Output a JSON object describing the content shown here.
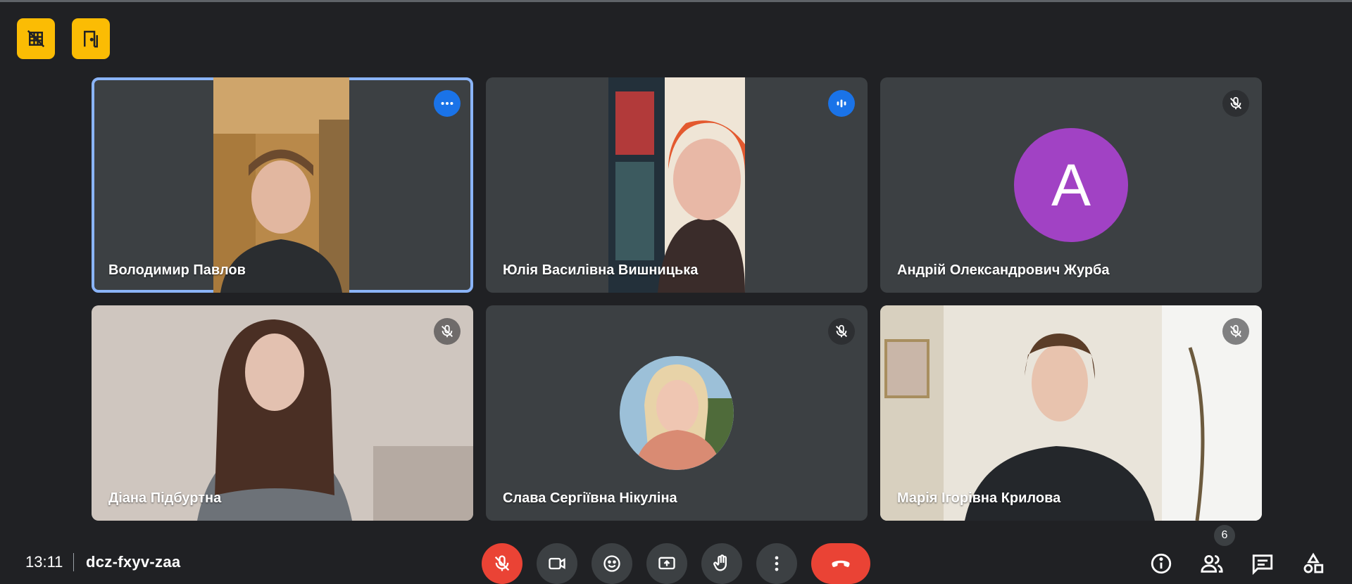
{
  "top_buttons": {
    "icon1": "hide-tiles-icon",
    "icon2": "leave-door-icon"
  },
  "tiles": [
    {
      "name": "Володимир Павлов",
      "badge": "more-options-icon",
      "state": "selected"
    },
    {
      "name": "Юлія Василівна Вишницька",
      "badge": "speaking-icon"
    },
    {
      "name": "Андрій Олександрович Журба",
      "badge": "mic-off-icon",
      "avatar_letter": "A",
      "avatar_color": "#a142c4"
    },
    {
      "name": "Діана Підбуртна",
      "badge": "mic-off-icon"
    },
    {
      "name": "Слава Сергіївна Нікуліна",
      "badge": "mic-off-icon"
    },
    {
      "name": "Марія Ігорівна Крилова",
      "badge": "mic-off-icon"
    }
  ],
  "bottom": {
    "time": "13:11",
    "meeting_code": "dcz-fxyv-zaa",
    "participants_count": "6"
  },
  "colors": {
    "accent": "#8ab4f8",
    "danger": "#ea4335",
    "warning": "#fbbc04",
    "bg": "#202124",
    "tile": "#3c4043"
  }
}
